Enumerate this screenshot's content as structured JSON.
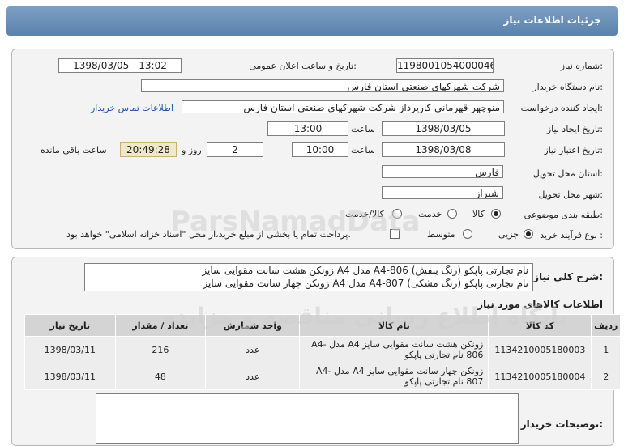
{
  "header": {
    "title": "جزئیات اطلاعات نیاز"
  },
  "fields": {
    "need_number_label": "شماره نیاز:",
    "need_number": "1198001054000046",
    "announce_label": "تاریخ و ساعت اعلان عمومی:",
    "announce_value": "1398/03/05 - 13:02",
    "buyer_org_label": "نام دستگاه خریدار:",
    "buyer_org": "شرکت شهرکهای صنعتی استان فارس",
    "requester_label": "ایجاد کننده درخواست:",
    "requester": "منوچهر  قهرمانی کارپرداز شرکت شهرکهای صنعتی استان فارس",
    "contact_link": "اطلاعات تماس خریدار",
    "created_label": "تاریخ ایجاد نیاز:",
    "created_date": "1398/03/05",
    "time_word": "ساعت",
    "created_time": "13:00",
    "validity_label": "تاریخ اعتبار نیاز:",
    "validity_date": "1398/03/08",
    "validity_time": "10:00",
    "days_value": "2",
    "days_word": "روز و",
    "remaining_time": "20:49:28",
    "remaining_word": "ساعت باقی مانده",
    "province_label": "استان محل تحویل:",
    "province": "فارس",
    "city_label": "شهر محل تحویل:",
    "city": "شیراز",
    "category_label": "طبقه بندی موضوعی:",
    "category_options": [
      "کالا",
      "خدمت",
      "کالا/خدمت"
    ],
    "process_label": "نوع فرآیند خرید :",
    "process_options": [
      "جزیی",
      "متوسط"
    ],
    "payment_note": "پرداخت تمام یا بخشی از مبلغ خرید،از محل \"اسناد خزانه اسلامی\" خواهد بود."
  },
  "summary": {
    "label": "شرح کلی نیاز:",
    "line1": "زونکن هشت سانت مقوایی سایز A4 مدل A4-806 نام تجارتی پاپکو (رنگ بنفش)",
    "line2": "زونکن چهار سانت مقوایی سایز A4 مدل A4-807 نام تجارتی پاپکو (رنگ مشکی)"
  },
  "goods": {
    "title": "اطلاعات کالاهای مورد نیاز",
    "columns": [
      "ردیف",
      "کد کالا",
      "نام کالا",
      "واحد شمارش",
      "تعداد / مقدار",
      "تاریخ نیاز"
    ],
    "rows": [
      [
        "1",
        "1134210005180003",
        "زونکن هشت سانت مقوایی سایز A4 مدل A4-806 نام تجارتی پاپکو",
        "عدد",
        "216",
        "1398/03/11"
      ],
      [
        "2",
        "1134210005180004",
        "زونکن چهار سانت مقوایی سایز A4 مدل A4-807 نام تجارتی پاپکو",
        "عدد",
        "48",
        "1398/03/11"
      ]
    ]
  },
  "buyer_notes": {
    "label": "توضیحات خریدار:"
  },
  "watermark": {
    "line1": "ParsNamadData",
    "line2": "پایگاه اطلاع رسانی مناقصه و مزایده"
  }
}
